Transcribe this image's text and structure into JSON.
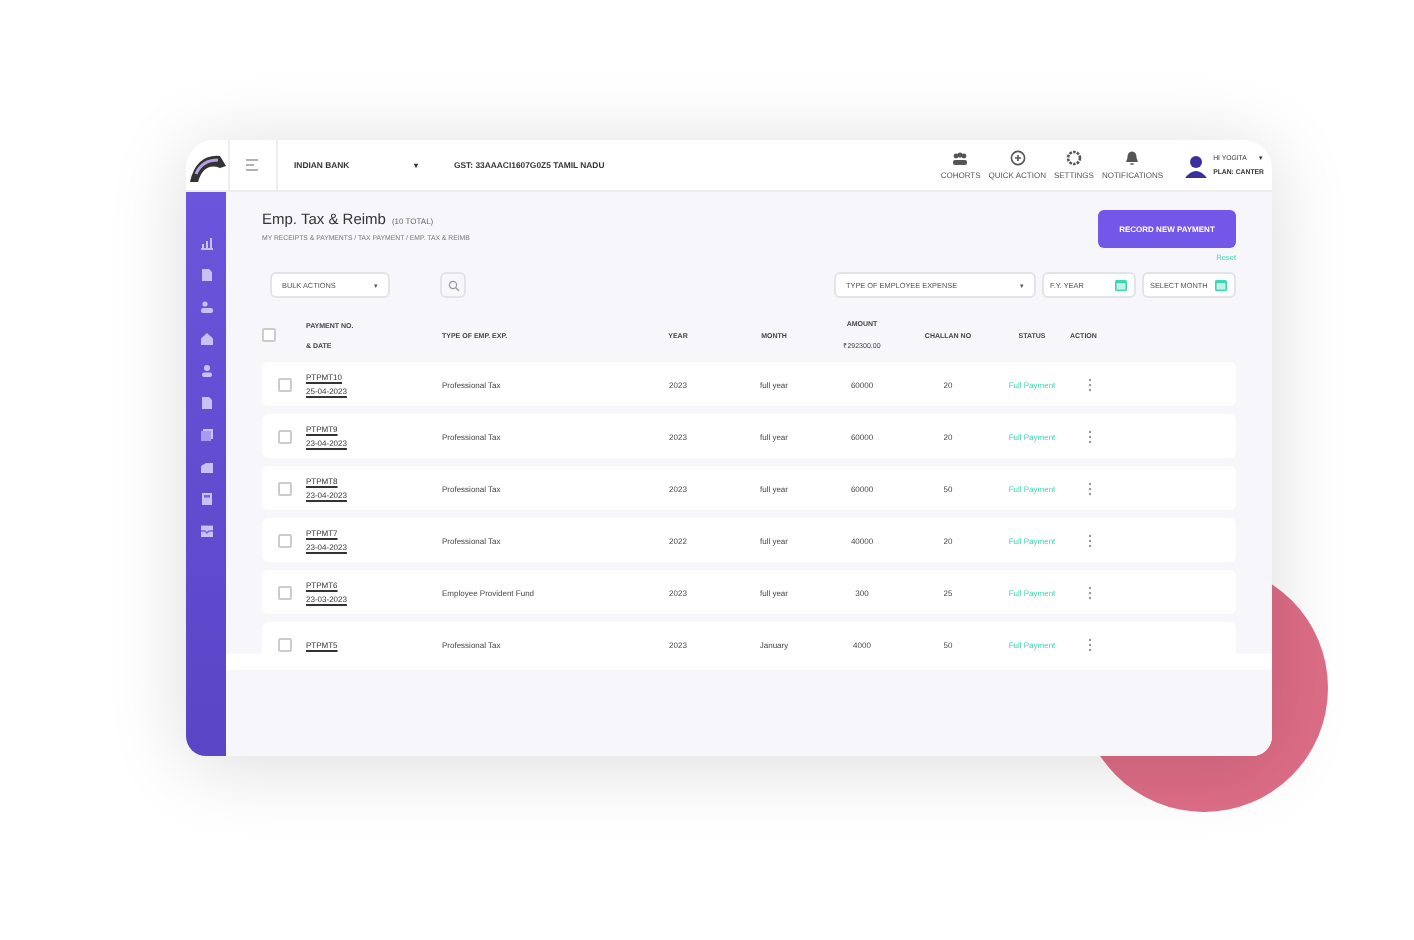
{
  "topbar": {
    "bank": "INDIAN BANK",
    "bank_caret": "▾",
    "gst": "GST: 33AAACI1607G0Z5 TAMIL NADU",
    "actions": [
      {
        "kind": "cohorts",
        "label": "COHORTS"
      },
      {
        "kind": "quick",
        "label": "QUICK ACTION"
      },
      {
        "kind": "settings",
        "label": "SETTINGS"
      },
      {
        "kind": "bell",
        "label": "NOTIFICATIONS"
      }
    ],
    "user": {
      "greeting": "HI YOGITA",
      "caret": "▾",
      "plan": "PLAN: CANTER"
    }
  },
  "sidebar": {
    "items": [
      {
        "kind": "chart"
      },
      {
        "kind": "doc"
      },
      {
        "kind": "people"
      },
      {
        "kind": "home"
      },
      {
        "kind": "person"
      },
      {
        "kind": "doc"
      },
      {
        "kind": "copy"
      },
      {
        "kind": "box"
      },
      {
        "kind": "calc"
      },
      {
        "kind": "inbox"
      }
    ]
  },
  "header": {
    "title": "Emp. Tax & Reimb",
    "count": "(10 TOTAL)",
    "breadcrumb": "MY RECEIPTS & PAYMENTS / TAX PAYMENT / EMP. TAX & REIMB",
    "button": "RECORD NEW PAYMENT"
  },
  "filters": {
    "reset": "Reset",
    "bulk": "BULK ACTIONS",
    "caret": "▾",
    "expense_type": "TYPE OF EMPLOYEE EXPENSE",
    "fy": "F.Y. YEAR",
    "month": "SELECT MONTH"
  },
  "table": {
    "header_checked": false,
    "columns": [
      {
        "label": "PAYMENT NO.",
        "label2": "& DATE"
      },
      {
        "label": "TYPE OF EMP. EXP."
      },
      {
        "label": "YEAR"
      },
      {
        "label": "MONTH"
      },
      {
        "label": "AMOUNT",
        "total": "₹292300.00"
      },
      {
        "label": "CHALLAN NO"
      },
      {
        "label": "STATUS"
      },
      {
        "label": "ACTION"
      }
    ],
    "rows": [
      {
        "checked": false,
        "no": "PTPMT10",
        "date": "25-04-2023",
        "type": "Professional Tax",
        "year": "2023",
        "month": "full year",
        "amount": "60000",
        "challan": "20",
        "status": "Full Payment"
      },
      {
        "checked": false,
        "no": "PTPMT9",
        "date": "23-04-2023",
        "type": "Professional Tax",
        "year": "2023",
        "month": "full year",
        "amount": "60000",
        "challan": "20",
        "status": "Full Payment"
      },
      {
        "checked": false,
        "no": "PTPMT8",
        "date": "23-04-2023",
        "type": "Professional Tax",
        "year": "2023",
        "month": "full year",
        "amount": "60000",
        "challan": "50",
        "status": "Full Payment"
      },
      {
        "checked": false,
        "no": "PTPMT7",
        "date": "23-04-2023",
        "type": "Professional Tax",
        "year": "2022",
        "month": "full year",
        "amount": "40000",
        "challan": "20",
        "status": "Full Payment"
      },
      {
        "checked": false,
        "no": "PTPMT6",
        "date": "23-03-2023",
        "type": "Employee Provident Fund",
        "year": "2023",
        "month": "full year",
        "amount": "300",
        "challan": "25",
        "status": "Full Payment"
      },
      {
        "checked": false,
        "no": "PTPMT5",
        "type": "Professional Tax",
        "year": "2023",
        "month": "January",
        "amount": "4000",
        "challan": "50",
        "status": "Full Payment"
      }
    ]
  }
}
